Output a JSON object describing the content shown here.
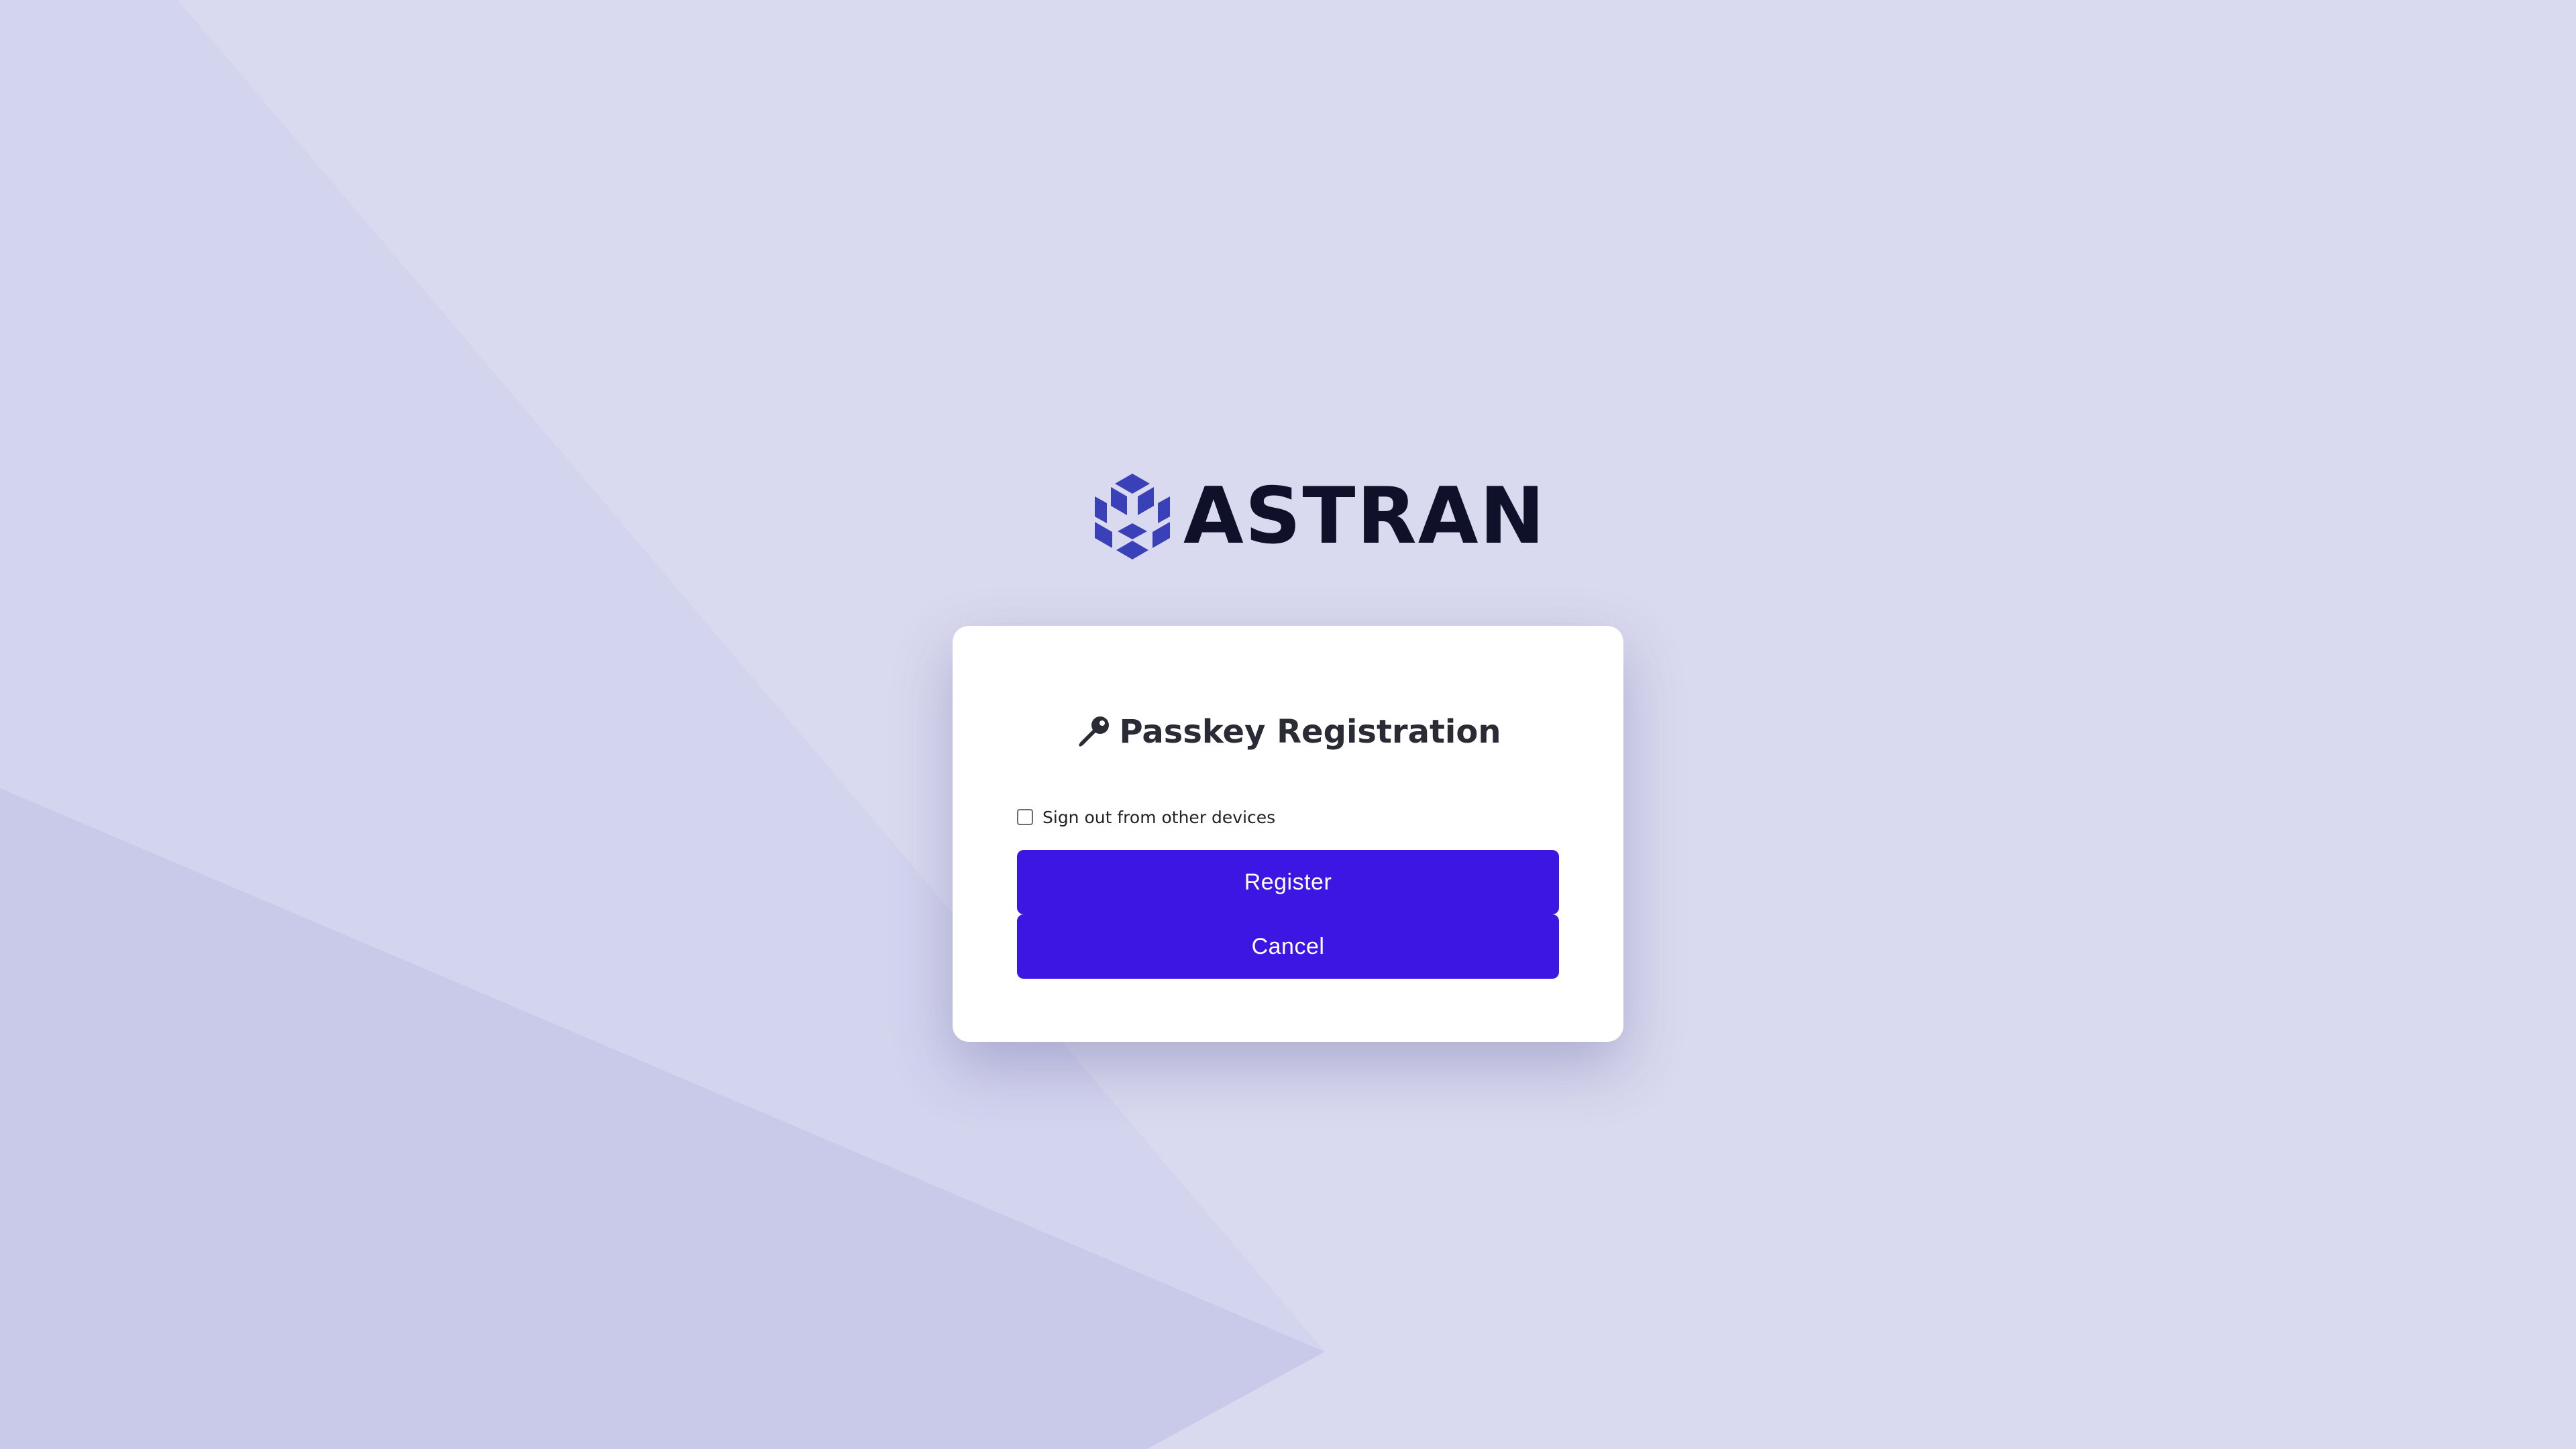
{
  "brand": {
    "name": "ASTRAN",
    "logo_icon": "hexagon-cube-logo-icon",
    "logo_color": "#3a41b8"
  },
  "dialog": {
    "title": "Passkey Registration",
    "title_icon": "key-icon",
    "checkbox": {
      "label": "Sign out from other devices",
      "checked": false
    },
    "register_label": "Register",
    "cancel_label": "Cancel"
  },
  "colors": {
    "background": "#d9daef",
    "accent": "#3d16e4",
    "text_dark": "#2b2b35"
  }
}
